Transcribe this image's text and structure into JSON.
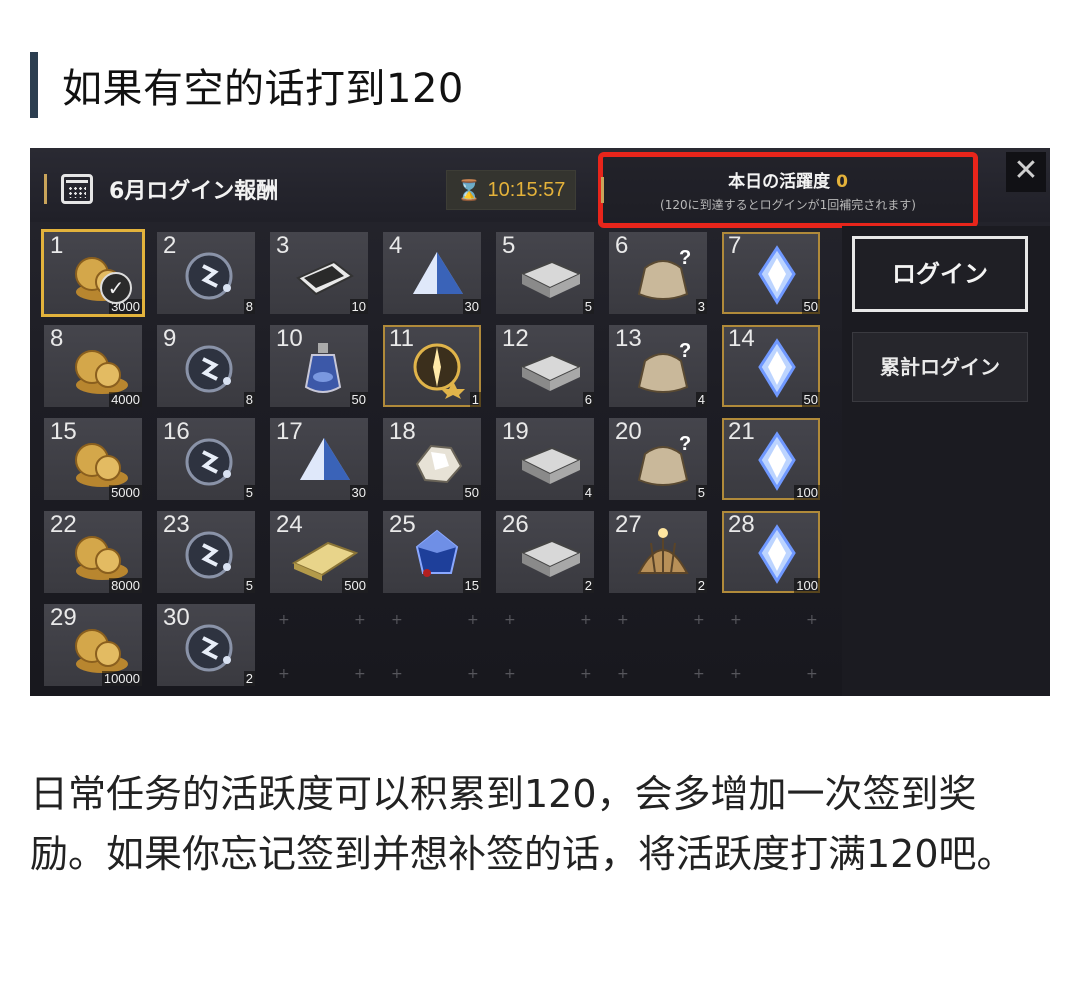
{
  "heading": "如果有空的话打到120",
  "game": {
    "title": "6月ログイン報酬",
    "timer": "10:15:57",
    "activity": {
      "label": "本日の活躍度",
      "value": "0",
      "note": "(120に到達するとログインが1回補完されます)"
    },
    "close_symbol": "✕",
    "buttons": {
      "login": "ログイン",
      "cumulative": "累計ログイン"
    },
    "days": [
      {
        "day": "1",
        "qty": "3000",
        "item": "coins",
        "claimed": true,
        "selected": true
      },
      {
        "day": "2",
        "qty": "8",
        "item": "rune",
        "gold": false
      },
      {
        "day": "3",
        "qty": "10",
        "item": "scroll",
        "gold": false
      },
      {
        "day": "4",
        "qty": "30",
        "item": "prism",
        "gold": false
      },
      {
        "day": "5",
        "qty": "5",
        "item": "box",
        "gold": false
      },
      {
        "day": "6",
        "qty": "3",
        "item": "bag",
        "gold": false
      },
      {
        "day": "7",
        "qty": "50",
        "item": "crystal",
        "gold": true
      },
      {
        "day": "8",
        "qty": "4000",
        "item": "coins",
        "gold": false
      },
      {
        "day": "9",
        "qty": "8",
        "item": "rune",
        "gold": false
      },
      {
        "day": "10",
        "qty": "50",
        "item": "potion",
        "gold": false
      },
      {
        "day": "11",
        "qty": "1",
        "item": "orb",
        "gold": true
      },
      {
        "day": "12",
        "qty": "6",
        "item": "box",
        "gold": false
      },
      {
        "day": "13",
        "qty": "4",
        "item": "bag",
        "gold": false
      },
      {
        "day": "14",
        "qty": "50",
        "item": "crystal",
        "gold": true
      },
      {
        "day": "15",
        "qty": "5000",
        "item": "coins",
        "gold": false
      },
      {
        "day": "16",
        "qty": "5",
        "item": "rune",
        "gold": false
      },
      {
        "day": "17",
        "qty": "30",
        "item": "prism",
        "gold": false
      },
      {
        "day": "18",
        "qty": "50",
        "item": "ore",
        "gold": false
      },
      {
        "day": "19",
        "qty": "4",
        "item": "box",
        "gold": false
      },
      {
        "day": "20",
        "qty": "5",
        "item": "bag",
        "gold": false
      },
      {
        "day": "21",
        "qty": "100",
        "item": "crystal",
        "gold": true
      },
      {
        "day": "22",
        "qty": "8000",
        "item": "coins",
        "gold": false
      },
      {
        "day": "23",
        "qty": "5",
        "item": "rune",
        "gold": false
      },
      {
        "day": "24",
        "qty": "500",
        "item": "gold-sheet",
        "gold": false
      },
      {
        "day": "25",
        "qty": "15",
        "item": "gem",
        "gold": false
      },
      {
        "day": "26",
        "qty": "2",
        "item": "box",
        "gold": false
      },
      {
        "day": "27",
        "qty": "2",
        "item": "shell",
        "gold": false
      },
      {
        "day": "28",
        "qty": "100",
        "item": "crystal",
        "gold": true
      },
      {
        "day": "29",
        "qty": "10000",
        "item": "coins",
        "gold": false
      },
      {
        "day": "30",
        "qty": "2",
        "item": "rune",
        "gold": false
      }
    ],
    "empty_marker": "+"
  },
  "body_text": "日常任务的活跃度可以积累到120，会多增加一次签到奖励。如果你忘记签到并想补签的话，将活跃度打满120吧。"
}
